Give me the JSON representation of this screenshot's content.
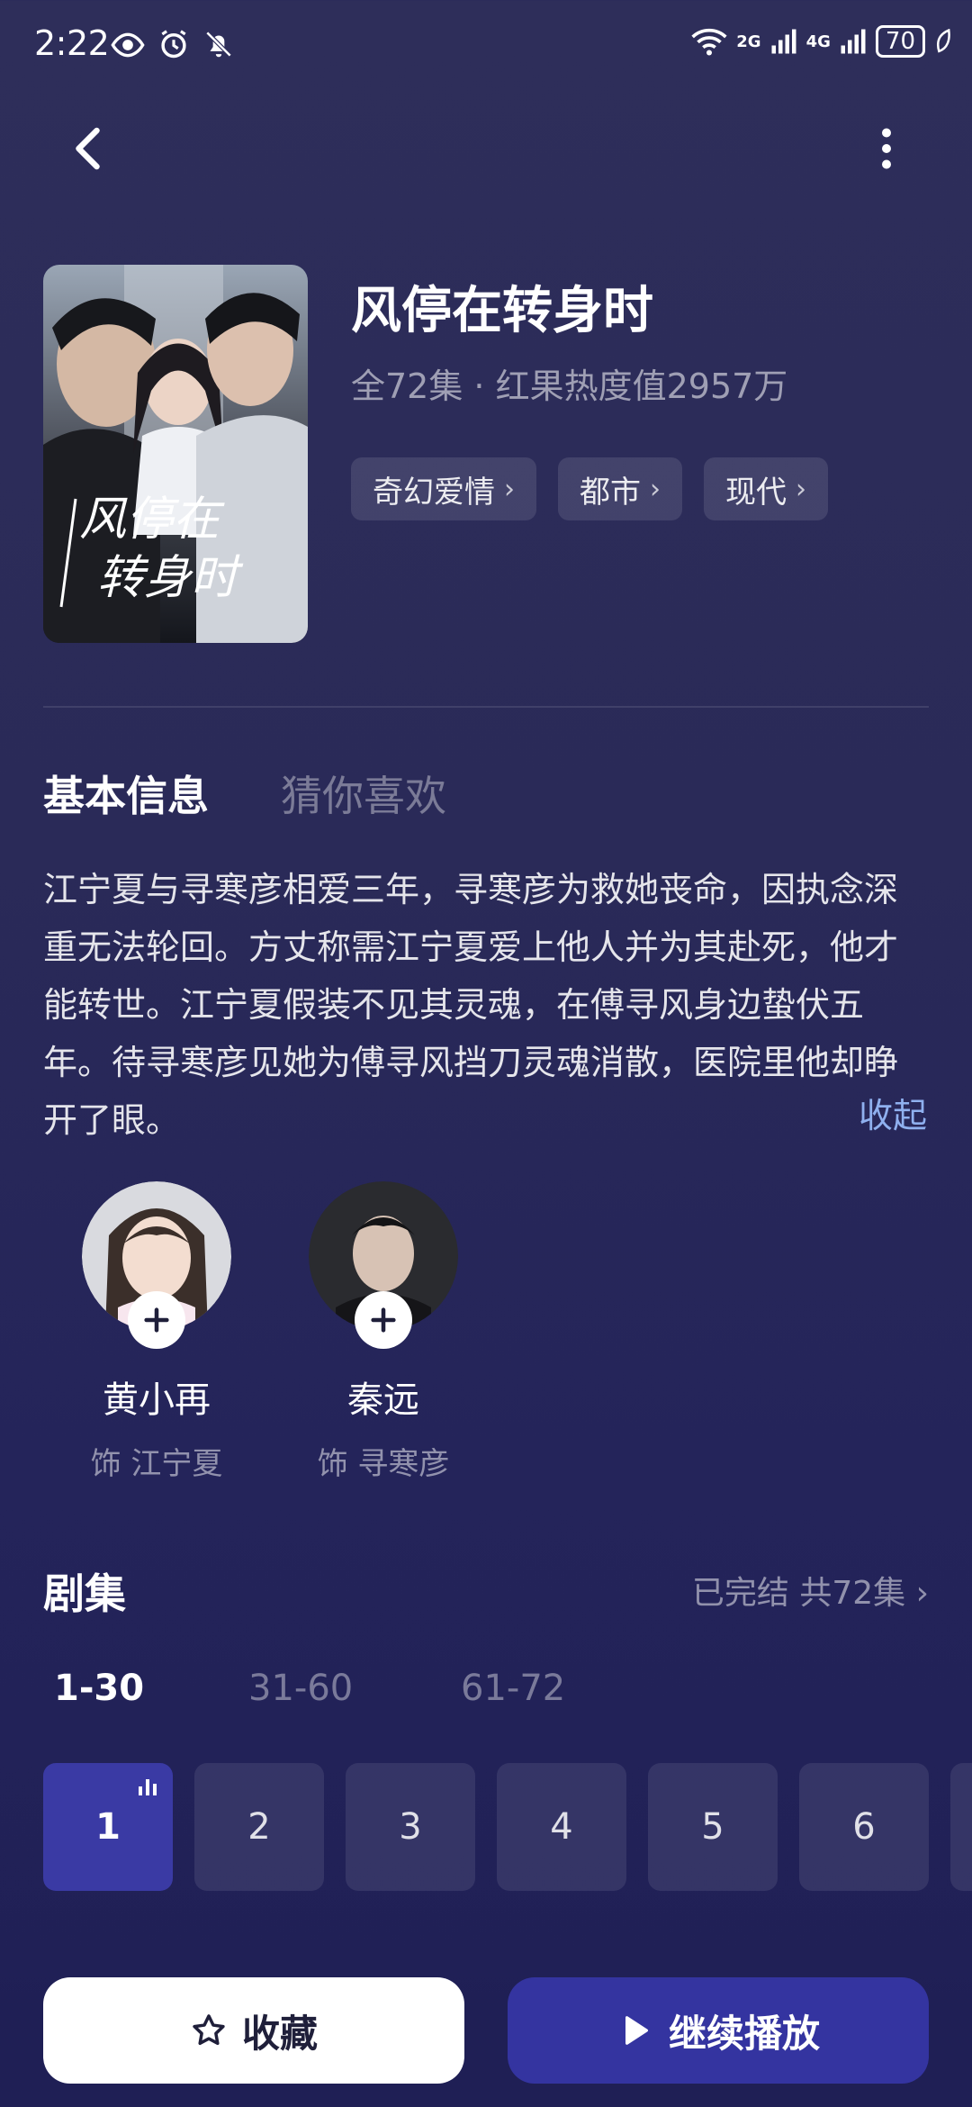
{
  "status_bar": {
    "time": "2:22",
    "net1": "2G",
    "net2": "4G",
    "battery": "70"
  },
  "header": {
    "back_icon": "chevron-left-icon",
    "more_icon": "more-vertical-icon"
  },
  "drama": {
    "title": "风停在转身时",
    "subtitle": "全72集 · 红果热度值2957万",
    "tags": [
      "奇幻爱情",
      "都市",
      "现代"
    ],
    "poster_text": "风停在转身时"
  },
  "tabs": {
    "basic": "基本信息",
    "guess": "猜你喜欢"
  },
  "synopsis": "江宁夏与寻寒彦相爱三年，寻寒彦为救她丧命，因执念深重无法轮回。方丈称需江宁夏爱上他人并为其赴死，他才能转世。江宁夏假装不见其灵魂，在傅寻风身边蛰伏五年。待寻寒彦见她为傅寻风挡刀灵魂消散，医院里他却睁开了眼。",
  "collapse_label": "收起",
  "cast": [
    {
      "name": "黄小再",
      "role": "饰 江宁夏"
    },
    {
      "name": "秦远",
      "role": "饰 寻寒彦"
    }
  ],
  "episodes": {
    "title": "剧集",
    "status": "已完结 共72集",
    "ranges": [
      "1-30",
      "31-60",
      "61-72"
    ],
    "items": [
      "1",
      "2",
      "3",
      "4",
      "5",
      "6"
    ],
    "active": "1"
  },
  "actions": {
    "favorite": "收藏",
    "continue": "继续播放"
  },
  "colors": {
    "accent": "#3434a0",
    "link": "#8fb0ef",
    "bg": "#2a2a58"
  }
}
